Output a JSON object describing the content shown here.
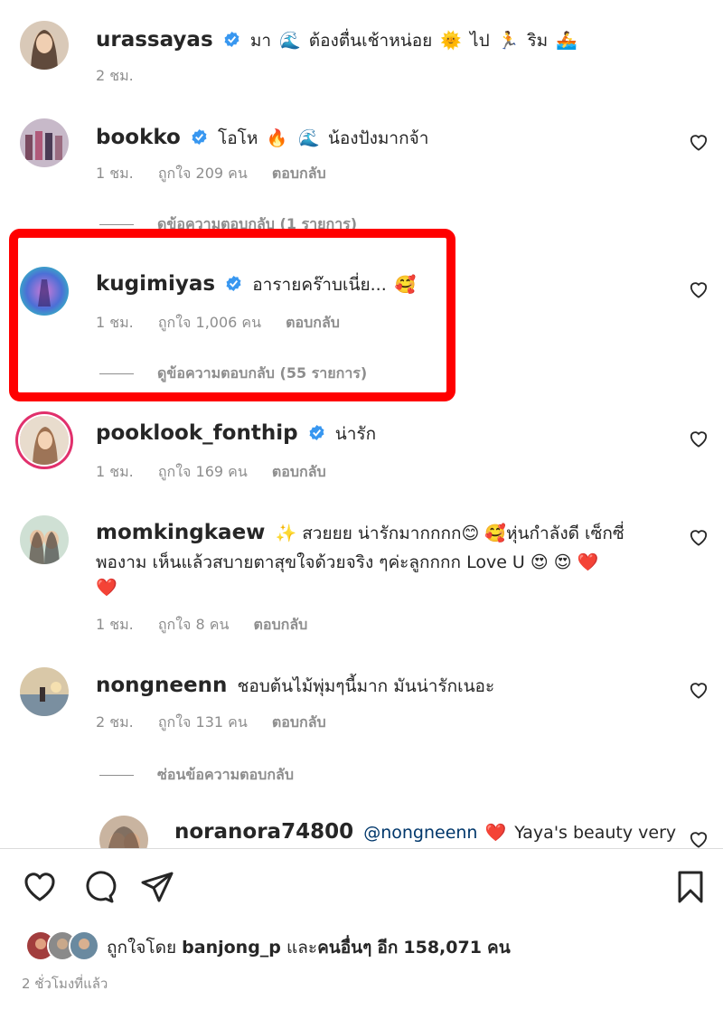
{
  "comments": [
    {
      "username": "urassayas",
      "verified": true,
      "text_parts": [
        "มา",
        "🌊",
        "ต้องตื่นเช้าหน่อย",
        "🌞",
        "ไป",
        "🏃",
        "ริม",
        "🚣"
      ],
      "time": "2 ชม.",
      "likes": "",
      "reply": "",
      "has_heart": false
    },
    {
      "username": "bookko",
      "verified": true,
      "text_parts": [
        "โอโห",
        "🔥",
        "🌊",
        "น้องปังมากจ้า"
      ],
      "time": "1 ชม.",
      "likes": "ถูกใจ 209 คน",
      "reply": "ตอบกลับ",
      "has_heart": true,
      "view_replies": "ดูข้อความตอบกลับ (1 รายการ)"
    },
    {
      "username": "kugimiyas",
      "verified": true,
      "text_parts": [
        "อารายคร๊าบเนี่ย...",
        "🥰"
      ],
      "time": "1 ชม.",
      "likes": "ถูกใจ 1,006 คน",
      "reply": "ตอบกลับ",
      "has_heart": true,
      "view_replies": "ดูข้อความตอบกลับ (55 รายการ)",
      "highlighted": true
    },
    {
      "username": "pooklook_fonthip",
      "verified": true,
      "text_parts": [
        "น่ารัก"
      ],
      "time": "1 ชม.",
      "likes": "ถูกใจ 169 คน",
      "reply": "ตอบกลับ",
      "has_heart": true
    },
    {
      "username": "momkingkaew",
      "verified": false,
      "text_line1": "✨ สวยยย น่ารักมากกกก😊 🥰หุ่นกำลังดี เซ็กซี่",
      "text_line2": "พองาม เห็นแล้วสบายตาสุขใจด้วยจริง ๆค่ะลูกกกก Love U 😍 😍 ❤️",
      "text_line3": "❤️",
      "time": "1 ชม.",
      "likes": "ถูกใจ 8 คน",
      "reply": "ตอบกลับ",
      "has_heart": true
    },
    {
      "username": "nongneenn",
      "verified": false,
      "text_parts": [
        "ชอบต้นไม้พุ่มๆนี้มาก มันน่ารักเนอะ"
      ],
      "time": "2 ชม.",
      "likes": "ถูกใจ 131 คน",
      "reply": "ตอบกลับ",
      "has_heart": true,
      "view_replies": "ซ่อนข้อความตอบกลับ"
    },
    {
      "username": "noranora74800",
      "verified": false,
      "mention": "@nongneenn",
      "text_parts": [
        "❤️",
        "Yaya's beauty very"
      ],
      "has_heart": true
    }
  ],
  "footer": {
    "likes_prefix": "ถูกใจโดย",
    "liker": "banjong_p",
    "and": "และ",
    "others": "คนอื่นๆ",
    "count_prefix": "อีก",
    "count": "158,071",
    "count_suffix": "คน",
    "posted": "2 ชั่วโมงที่แล้ว"
  },
  "colors": {
    "highlight": "#ff0000",
    "verified": "#3897f0",
    "text": "#262626",
    "muted": "#8e8e8e"
  }
}
